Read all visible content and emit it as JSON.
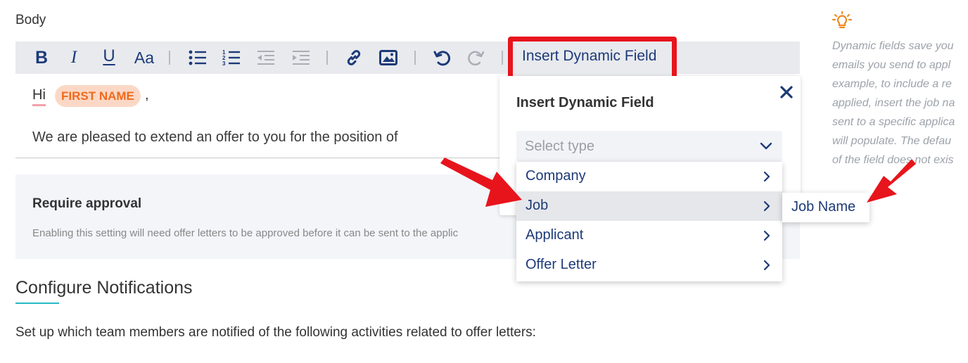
{
  "body_label": "Body",
  "toolbar": {
    "insert_dynamic_field": "Insert Dynamic Field",
    "bold": "B",
    "italic": "I",
    "underline": "U",
    "font_size": "Aa",
    "icons": [
      "bulleted-list-icon",
      "numbered-list-icon",
      "outdent-icon",
      "indent-icon",
      "link-icon",
      "image-icon",
      "undo-icon",
      "redo-icon"
    ]
  },
  "editor": {
    "greeting": "Hi",
    "first_name_chip": "FIRST NAME",
    "comma": ",",
    "line2": "We are pleased to extend an offer to you for the position of"
  },
  "approval": {
    "title": "Require approval",
    "description": "Enabling this setting will need offer letters to be approved before it can be sent to the applic"
  },
  "notifications": {
    "title": "Configure Notifications",
    "description": "Set up which team members are notified of the following activities related to offer letters:"
  },
  "popover": {
    "title": "Insert Dynamic Field",
    "select_placeholder": "Select type",
    "options": [
      {
        "label": "Company"
      },
      {
        "label": "Job"
      },
      {
        "label": "Applicant"
      },
      {
        "label": "Offer Letter"
      }
    ],
    "active_option": "Job",
    "submenu_item": "Job Name"
  },
  "hint": {
    "lines": [
      "Dynamic fields save you",
      "emails you send to appl",
      "example, to include a re",
      "applied, insert the job na",
      "sent to a specific applica",
      "will populate. The defau",
      "of the field does not exis"
    ]
  },
  "colors": {
    "accent_navy": "#1d3a78",
    "highlight_red": "#e8141c",
    "chip_bg": "#fbd8c5",
    "chip_text": "#ef6a1e",
    "teal_underline": "#27b9c6",
    "bulb_orange": "#f08a24"
  }
}
